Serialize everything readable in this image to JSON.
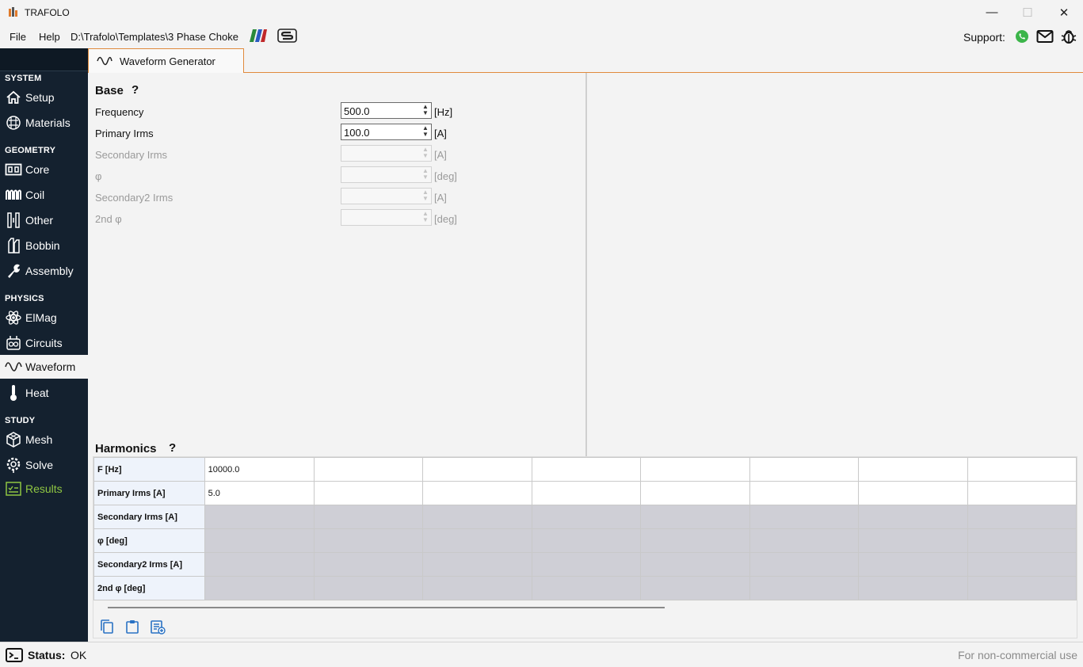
{
  "window": {
    "title": "TRAFOLO",
    "minimize": "—",
    "maximize": "☐",
    "close": "✕"
  },
  "menu": {
    "file": "File",
    "help": "Help",
    "path": "D:\\Trafolo\\Templates\\3 Phase Choke",
    "support": "Support:"
  },
  "sidebar": {
    "sections": [
      {
        "title": "SYSTEM",
        "items": [
          {
            "label": "Setup",
            "icon": "home-icon"
          },
          {
            "label": "Materials",
            "icon": "grid-icon"
          }
        ]
      },
      {
        "title": "GEOMETRY",
        "items": [
          {
            "label": "Core",
            "icon": "core-icon"
          },
          {
            "label": "Coil",
            "icon": "coil-icon"
          },
          {
            "label": "Other",
            "icon": "other-icon"
          },
          {
            "label": "Bobbin",
            "icon": "bobbin-icon"
          },
          {
            "label": "Assembly",
            "icon": "wrench-icon"
          }
        ]
      },
      {
        "title": "PHYSICS",
        "items": [
          {
            "label": "ElMag",
            "icon": "atom-icon"
          },
          {
            "label": "Circuits",
            "icon": "circuit-icon"
          },
          {
            "label": "Waveform",
            "icon": "sine-wave-icon"
          },
          {
            "label": "Heat",
            "icon": "thermometer-icon"
          }
        ]
      },
      {
        "title": "STUDY",
        "items": [
          {
            "label": "Mesh",
            "icon": "cube-icon"
          },
          {
            "label": "Solve",
            "icon": "gear-icon"
          },
          {
            "label": "Results",
            "icon": "checklist-icon"
          }
        ]
      }
    ]
  },
  "tab": {
    "label": "Waveform Generator",
    "icon": "sine-wave-icon"
  },
  "base": {
    "heading": "Base",
    "help": "?",
    "fields": [
      {
        "label": "Frequency",
        "value": "500.0",
        "unit": "[Hz]",
        "enabled": true
      },
      {
        "label": "Primary Irms",
        "value": "100.0",
        "unit": "[A]",
        "enabled": true
      },
      {
        "label": "Secondary Irms",
        "value": "",
        "unit": "[A]",
        "enabled": false
      },
      {
        "label": "φ",
        "value": "",
        "unit": "[deg]",
        "enabled": false
      },
      {
        "label": "Secondary2 Irms",
        "value": "",
        "unit": "[A]",
        "enabled": false
      },
      {
        "label": "2nd φ",
        "value": "",
        "unit": "[deg]",
        "enabled": false
      }
    ]
  },
  "harmonics": {
    "heading": "Harmonics",
    "help": "?",
    "rows": [
      {
        "header": "F [Hz]",
        "cells": [
          "10000.0",
          "",
          "",
          "",
          "",
          "",
          "",
          ""
        ],
        "disabled": false
      },
      {
        "header": "Primary Irms [A]",
        "cells": [
          "5.0",
          "",
          "",
          "",
          "",
          "",
          "",
          ""
        ],
        "disabled": false
      },
      {
        "header": "Secondary Irms [A]",
        "cells": [
          "",
          "",
          "",
          "",
          "",
          "",
          "",
          ""
        ],
        "disabled": true
      },
      {
        "header": "φ [deg]",
        "cells": [
          "",
          "",
          "",
          "",
          "",
          "",
          "",
          ""
        ],
        "disabled": true
      },
      {
        "header": "Secondary2 Irms [A]",
        "cells": [
          "",
          "",
          "",
          "",
          "",
          "",
          "",
          ""
        ],
        "disabled": true
      },
      {
        "header": "2nd φ [deg]",
        "cells": [
          "",
          "",
          "",
          "",
          "",
          "",
          "",
          ""
        ],
        "disabled": true
      }
    ]
  },
  "status": {
    "label": "Status:",
    "value": "OK",
    "license": "For non-commercial use"
  },
  "colors": {
    "sidebar": "#14212f",
    "accent": "#e08a3c",
    "results": "#8fc642",
    "icon_blue": "#2a72c4"
  }
}
